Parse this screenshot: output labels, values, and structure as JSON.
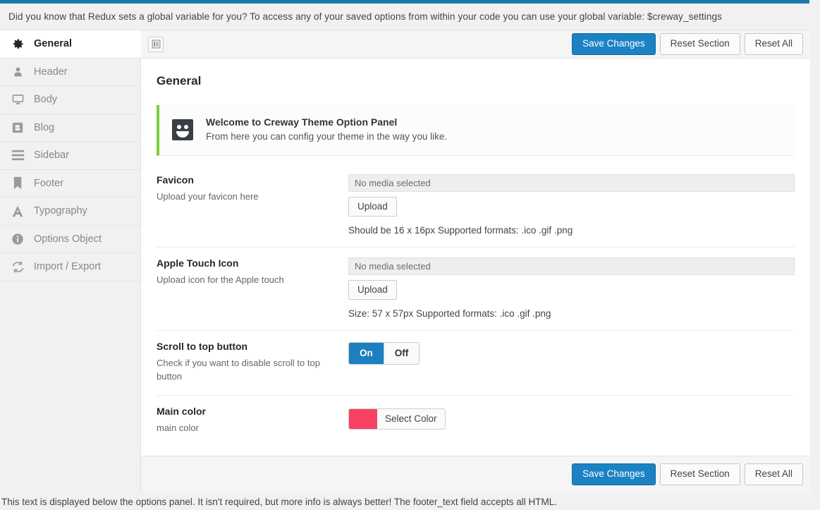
{
  "notice": {
    "text": "Did you know that Redux sets a global variable for you? To access any of your saved options from within your code you can use your global variable: $creway_settings"
  },
  "theme": {
    "accent_blue": "#1c7aad",
    "primary_button": "#1c82c4",
    "info_green": "#7ad03a",
    "main_color_swatch": "#f94263"
  },
  "sidebar": {
    "items": [
      {
        "label": "General",
        "icon": "gear-icon",
        "active": true
      },
      {
        "label": "Header",
        "icon": "user-icon",
        "active": false
      },
      {
        "label": "Body",
        "icon": "monitor-icon",
        "active": false
      },
      {
        "label": "Blog",
        "icon": "blog-icon",
        "active": false
      },
      {
        "label": "Sidebar",
        "icon": "menu-lines-icon",
        "active": false
      },
      {
        "label": "Footer",
        "icon": "bookmark-icon",
        "active": false
      },
      {
        "label": "Typography",
        "icon": "letter-a-icon",
        "active": false
      },
      {
        "label": "Options Object",
        "icon": "info-circle-icon",
        "active": false
      },
      {
        "label": "Import / Export",
        "icon": "refresh-icon",
        "active": false
      }
    ]
  },
  "toolbar": {
    "expand_icon": "expand-panel-icon",
    "save_label": "Save Changes",
    "reset_section_label": "Reset Section",
    "reset_all_label": "Reset All"
  },
  "main": {
    "section_title": "General",
    "info_box": {
      "icon": "smiley-face-icon",
      "title": "Welcome to Creway Theme Option Panel",
      "subtitle": "From here you can config your theme in the way you like."
    },
    "fields": [
      {
        "title": "Favicon",
        "description": "Upload your favicon here",
        "media_value": "No media selected",
        "upload_label": "Upload",
        "hint": "Should be 16 x 16px Supported formats: .ico .gif .png"
      },
      {
        "title": "Apple Touch Icon",
        "description": "Upload icon for the Apple touch",
        "media_value": "No media selected",
        "upload_label": "Upload",
        "hint": "Size: 57 x 57px Supported formats: .ico .gif .png"
      },
      {
        "title": "Scroll to top button",
        "description": "Check if you want to disable scroll to top button",
        "toggle_on_label": "On",
        "toggle_off_label": "Off",
        "toggle_value": "On"
      },
      {
        "title": "Main color",
        "description": "main color",
        "color_button_label": "Select Color",
        "color_value": "#f94263"
      }
    ]
  },
  "footer": {
    "save_label": "Save Changes",
    "reset_section_label": "Reset Section",
    "reset_all_label": "Reset All",
    "below_panel_text": "This text is displayed below the options panel. It isn't required, but more info is always better! The footer_text field accepts all HTML."
  }
}
